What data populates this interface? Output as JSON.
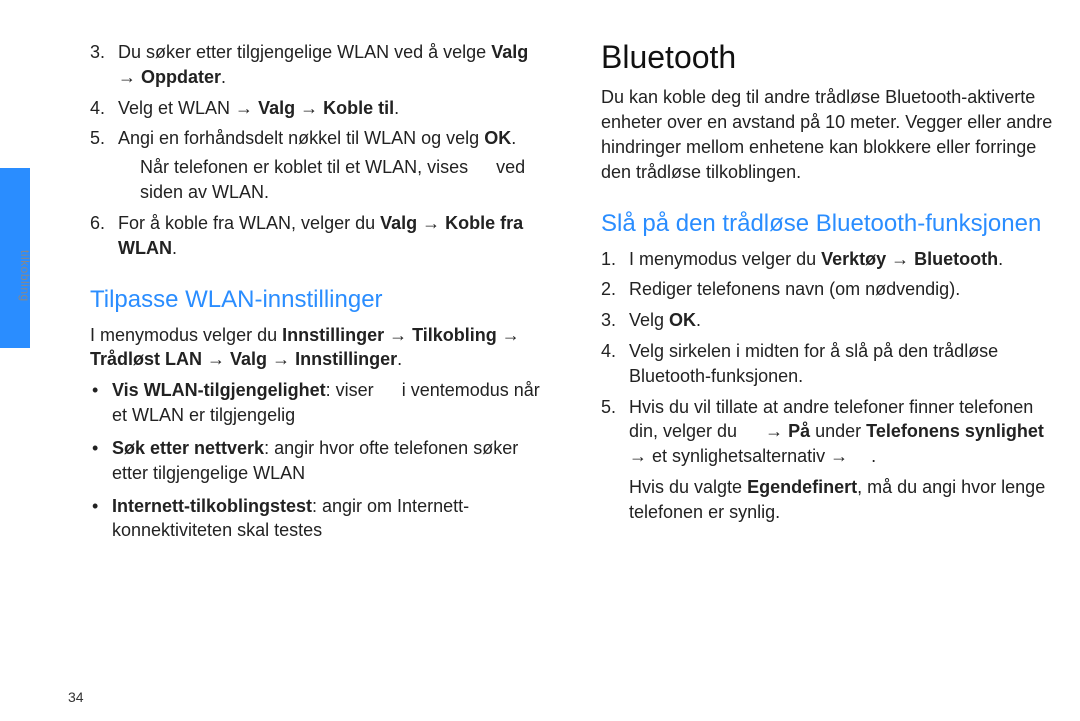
{
  "sidebar": {
    "label": "tilkobling"
  },
  "page_number": "34",
  "left": {
    "items": {
      "i3": {
        "pre": "Du søker etter tilgjengelige WLAN ved å velge ",
        "b1": "Valg",
        "arrow": " → ",
        "b2": "Oppdater",
        "post": "."
      },
      "i4": {
        "pre": "Velg et WLAN → ",
        "b1": "Valg",
        "arrow": " → ",
        "b2": "Koble til",
        "post": "."
      },
      "i5": {
        "pre": "Angi en forhåndsdelt nøkkel til WLAN og velg ",
        "b1": "OK",
        "post": ".",
        "note_pre": "Når telefonen er koblet til et WLAN, vises ",
        "note_post": " ved siden av WLAN."
      },
      "i6": {
        "pre": "For å koble fra WLAN, velger du ",
        "b1": "Valg",
        "arrow": " → ",
        "b2": "Koble fra WLAN",
        "post": "."
      }
    },
    "h2": "Tilpasse WLAN-innstillinger",
    "para": {
      "pre": "I menymodus velger du ",
      "b1": "Innstillinger",
      "a1": " → ",
      "b2": "Tilkobling",
      "a2": " → ",
      "b3": "Trådløst LAN",
      "a3": " → ",
      "b4": "Valg",
      "a4": " → ",
      "b5": "Innstillinger",
      "post": "."
    },
    "bullets": {
      "b1": {
        "label": "Vis WLAN-tilgjengelighet",
        "pre": ": viser ",
        "post": " i ventemodus når et WLAN er tilgjengelig"
      },
      "b2": {
        "label": "Søk etter nettverk",
        "desc": ": angir hvor ofte telefonen søker etter tilgjengelige WLAN"
      },
      "b3": {
        "label": "Internett-tilkoblingstest",
        "desc": ": angir om Internett-konnektiviteten skal testes"
      }
    }
  },
  "right": {
    "h1": "Bluetooth",
    "intro": "Du kan koble deg til andre trådløse Bluetooth-aktiverte enheter over en avstand på 10 meter. Vegger eller andre hindringer mellom enhetene kan blokkere eller forringe den trådløse tilkoblingen.",
    "h2": "Slå på den trådløse Bluetooth-funksjonen",
    "items": {
      "i1": {
        "pre": "I menymodus velger du ",
        "b1": "Verktøy",
        "arrow": " → ",
        "b2": "Bluetooth",
        "post": "."
      },
      "i2": {
        "text": "Rediger telefonens navn (om nødvendig)."
      },
      "i3": {
        "pre": "Velg ",
        "b1": "OK",
        "post": "."
      },
      "i4": {
        "text": "Velg sirkelen i midten for å slå på den trådløse Bluetooth-funksjonen."
      },
      "i5": {
        "pre": "Hvis du vil tillate at andre telefoner finner telefonen din, velger du ",
        "arrow1": " → ",
        "b1": "På",
        "mid1": " under ",
        "b2": "Telefonens synlighet",
        "arrow2": " → ",
        "mid2": "et synlighetsalternativ → ",
        "post": "."
      }
    },
    "tail": {
      "pre": "Hvis du valgte ",
      "b1": "Egendefinert",
      "post": ", må du angi hvor lenge telefonen er synlig."
    }
  }
}
